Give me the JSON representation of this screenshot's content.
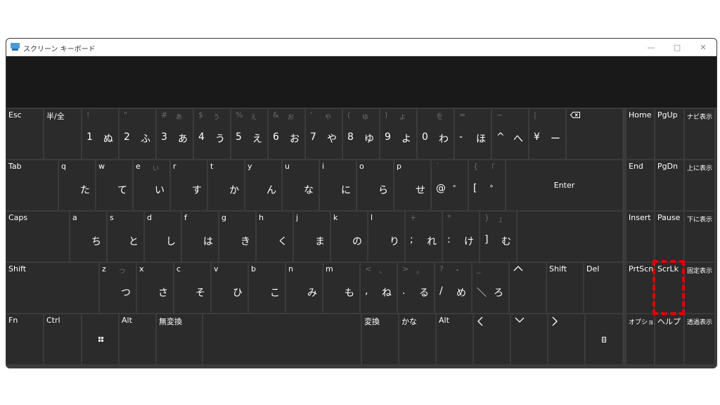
{
  "window": {
    "title": "スクリーン キーボード",
    "minimize": "—",
    "maximize": "□",
    "close": "✕"
  },
  "keys": {
    "esc": "Esc",
    "hankaku": "半/全",
    "n1": {
      "sh": "!",
      "sk": "",
      "m": "1",
      "k": "ぬ"
    },
    "n2": {
      "sh": "\"",
      "sk": "",
      "m": "2",
      "k": "ふ"
    },
    "n3": {
      "sh": "#",
      "sk": "ぁ",
      "m": "3",
      "k": "あ"
    },
    "n4": {
      "sh": "$",
      "sk": "ぅ",
      "m": "4",
      "k": "う"
    },
    "n5": {
      "sh": "%",
      "sk": "ぇ",
      "m": "5",
      "k": "え"
    },
    "n6": {
      "sh": "&",
      "sk": "ぉ",
      "m": "6",
      "k": "お"
    },
    "n7": {
      "sh": "'",
      "sk": "ゃ",
      "m": "7",
      "k": "や"
    },
    "n8": {
      "sh": "(",
      "sk": "ゅ",
      "m": "8",
      "k": "ゆ"
    },
    "n9": {
      "sh": ")",
      "sk": "ょ",
      "m": "9",
      "k": "よ"
    },
    "n0": {
      "sh": "",
      "sk": "を",
      "m": "0",
      "k": "わ"
    },
    "minus": {
      "sh": "=",
      "sk": "",
      "m": "-",
      "k": "ほ"
    },
    "caret": {
      "sh": "~",
      "sk": "",
      "m": "^",
      "k": "へ"
    },
    "yen": {
      "sh": "|",
      "sk": "",
      "m": "¥",
      "k": "ー"
    },
    "tab": "Tab",
    "q": {
      "l": "q",
      "k": "た"
    },
    "w": {
      "l": "w",
      "k": "て"
    },
    "e": {
      "l": "e",
      "sk": "ぃ",
      "k": "い"
    },
    "r": {
      "l": "r",
      "k": "す"
    },
    "t": {
      "l": "t",
      "k": "か"
    },
    "y": {
      "l": "y",
      "k": "ん"
    },
    "u": {
      "l": "u",
      "k": "な"
    },
    "i": {
      "l": "i",
      "k": "に"
    },
    "o": {
      "l": "o",
      "k": "ら"
    },
    "p": {
      "l": "p",
      "k": "せ"
    },
    "at": {
      "sh": "`",
      "m": "@",
      "k": "゛"
    },
    "bracket": {
      "sh": "{",
      "sk": "「",
      "m": "[",
      "k": "゜"
    },
    "enter": "Enter",
    "caps": "Caps",
    "a": {
      "l": "a",
      "k": "ち"
    },
    "s": {
      "l": "s",
      "k": "と"
    },
    "d": {
      "l": "d",
      "k": "し"
    },
    "f": {
      "l": "f",
      "k": "は"
    },
    "g": {
      "l": "g",
      "k": "き"
    },
    "h": {
      "l": "h",
      "k": "く"
    },
    "j": {
      "l": "j",
      "k": "ま"
    },
    "k": {
      "l": "k",
      "k": "の"
    },
    "l": {
      "l": "l",
      "k": "り"
    },
    "semi": {
      "sh": "+",
      "m": ";",
      "k": "れ"
    },
    "colon": {
      "sh": "*",
      "m": ":",
      "k": "け"
    },
    "rbracket": {
      "sh": "}",
      "sk": "」",
      "m": "]",
      "k": "む"
    },
    "shift": "Shift",
    "z": {
      "l": "z",
      "sk": "っ",
      "k": "つ"
    },
    "x": {
      "l": "x",
      "k": "さ"
    },
    "c": {
      "l": "c",
      "k": "そ"
    },
    "v": {
      "l": "v",
      "k": "ひ"
    },
    "b": {
      "l": "b",
      "k": "こ"
    },
    "n": {
      "l": "n",
      "k": "み"
    },
    "m": {
      "l": "m",
      "k": "も"
    },
    "comma": {
      "sh": "<",
      "sk": "、",
      "m": ",",
      "k": "ね"
    },
    "period": {
      "sh": ">",
      "sk": "。",
      "m": ".",
      "k": "る"
    },
    "slash": {
      "sh": "?",
      "sk": "・",
      "m": "/",
      "k": "め"
    },
    "backslash": {
      "sh": "_",
      "sk": "",
      "m": "＼",
      "k": "ろ"
    },
    "rshift": "Shift",
    "del": "Del",
    "fn": "Fn",
    "ctrl": "Ctrl",
    "alt": "Alt",
    "muhenkan": "無変換",
    "henkan": "変換",
    "kana": "かな",
    "ralt": "Alt",
    "home": "Home",
    "pgup": "PgUp",
    "navshow": "ナビ表示",
    "end": "End",
    "pgdn": "PgDn",
    "upshow": "上に表示",
    "insert": "Insert",
    "pause": "Pause",
    "downshow": "下に表示",
    "prtscn": "PrtScn",
    "scrlk": "ScrLk",
    "fixshow": "固定表示",
    "options": "オプション",
    "help": "ヘルプ",
    "transparent": "透過表示"
  },
  "colors": {
    "key": "#2b2b2b",
    "keyboard_bg": "#3b3b3b",
    "highlight": "#e00000"
  }
}
